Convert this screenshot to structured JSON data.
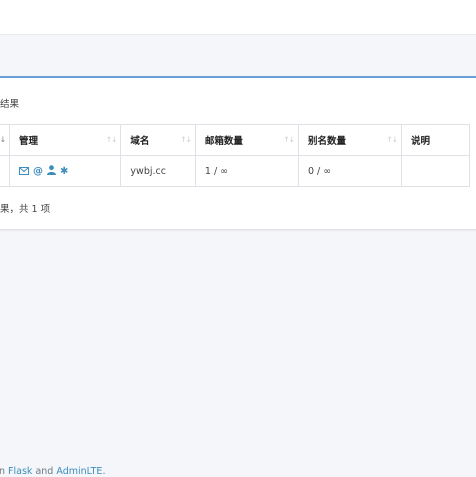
{
  "header": {},
  "card": {
    "result_title": "结果"
  },
  "table": {
    "headers": [
      "",
      "管理",
      "域名",
      "邮箱数量",
      "别名数量",
      "说明"
    ],
    "rows": [
      {
        "icons": [
          "mail-icon",
          "at-icon",
          "user-icon",
          "asterisk-icon"
        ],
        "domain": "ywbj.cc",
        "mailbox_count": "1 / ∞",
        "alias_count": "0 / ∞",
        "description": ""
      }
    ]
  },
  "summary": "果，共 1 项",
  "footer": {
    "prefix": "n ",
    "link1": "Flask",
    "and": " and ",
    "link2": "AdminLTE",
    "suffix": "."
  },
  "colors": {
    "accent": "#3c8dbc",
    "card_top_border": "#6aa0d8",
    "background": "#f4f6f9"
  }
}
